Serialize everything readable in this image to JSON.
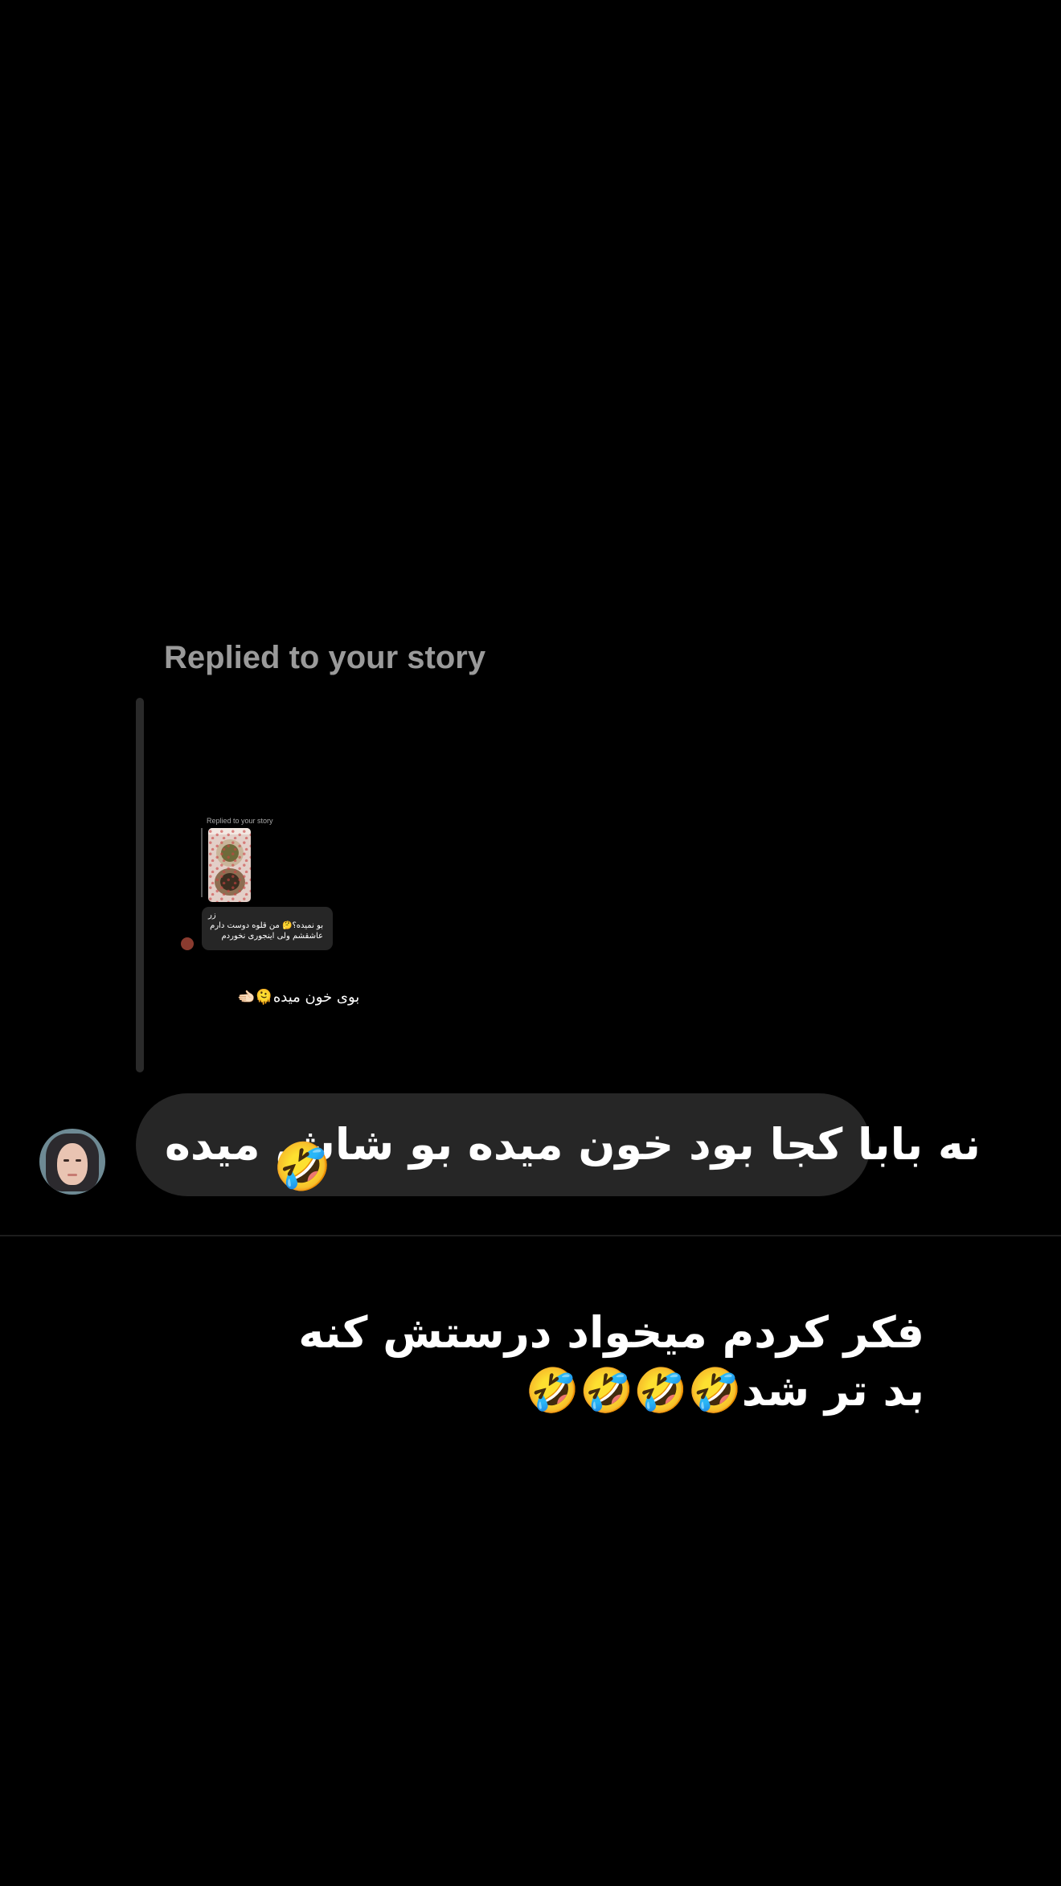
{
  "story_reply": {
    "label": "Replied to your story"
  },
  "embedded_reply": {
    "label": "Replied to your story",
    "message_line1": "زر",
    "message_line2": "بو نمیده؟🤔 من قلوه دوست دارم",
    "message_line3": "عاشقشم ولی اینجوری نخوردم",
    "footer_text": "بوی خون میده🫠🫲🏻"
  },
  "message": {
    "text": "نه بابا کجا بود خون میده بو شاش میده",
    "emoji": "🤣"
  },
  "caption": {
    "line1": "فکر کردم میخواد درستش کنه",
    "line2": "بد تر شد🤣🤣🤣🤣"
  }
}
